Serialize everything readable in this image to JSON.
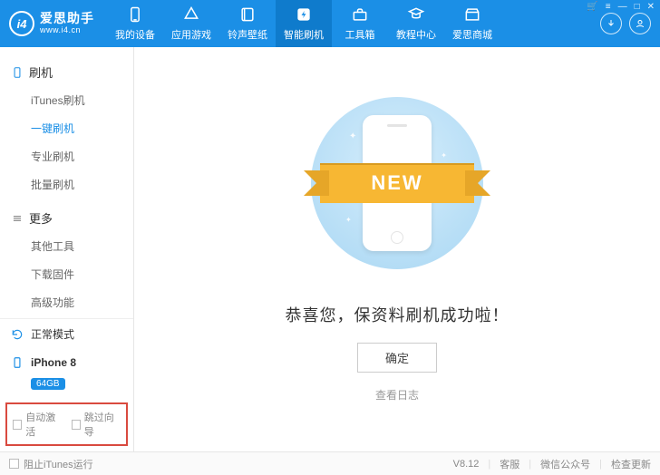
{
  "logo": {
    "icon_text": "i4",
    "main": "爱思助手",
    "sub": "www.i4.cn"
  },
  "topnav": [
    {
      "icon": "device",
      "label": "我的设备"
    },
    {
      "icon": "apps",
      "label": "应用游戏"
    },
    {
      "icon": "ringtone",
      "label": "铃声壁纸"
    },
    {
      "icon": "flash",
      "label": "智能刷机",
      "active": true
    },
    {
      "icon": "toolbox",
      "label": "工具箱"
    },
    {
      "icon": "tutorial",
      "label": "教程中心"
    },
    {
      "icon": "store",
      "label": "爱思商城"
    }
  ],
  "sidebar": {
    "sections": [
      {
        "icon": "flash-outline",
        "title": "刷机",
        "items": [
          {
            "label": "iTunes刷机"
          },
          {
            "label": "一键刷机",
            "active": true
          },
          {
            "label": "专业刷机"
          },
          {
            "label": "批量刷机"
          }
        ]
      },
      {
        "icon": "more",
        "title": "更多",
        "items": [
          {
            "label": "其他工具"
          },
          {
            "label": "下载固件"
          },
          {
            "label": "高级功能"
          }
        ]
      }
    ],
    "mode": {
      "icon": "refresh",
      "label": "正常模式"
    },
    "device": {
      "icon": "phone",
      "name": "iPhone 8",
      "badge": "64GB"
    },
    "checkboxes": [
      {
        "label": "自动激活"
      },
      {
        "label": "跳过向导"
      }
    ]
  },
  "main": {
    "ribbon": "NEW",
    "success_text": "恭喜您，保资料刷机成功啦！",
    "ok_button": "确定",
    "view_log": "查看日志"
  },
  "footer": {
    "block_itunes": "阻止iTunes运行",
    "version": "V8.12",
    "links": [
      "客服",
      "微信公众号",
      "检查更新"
    ]
  }
}
